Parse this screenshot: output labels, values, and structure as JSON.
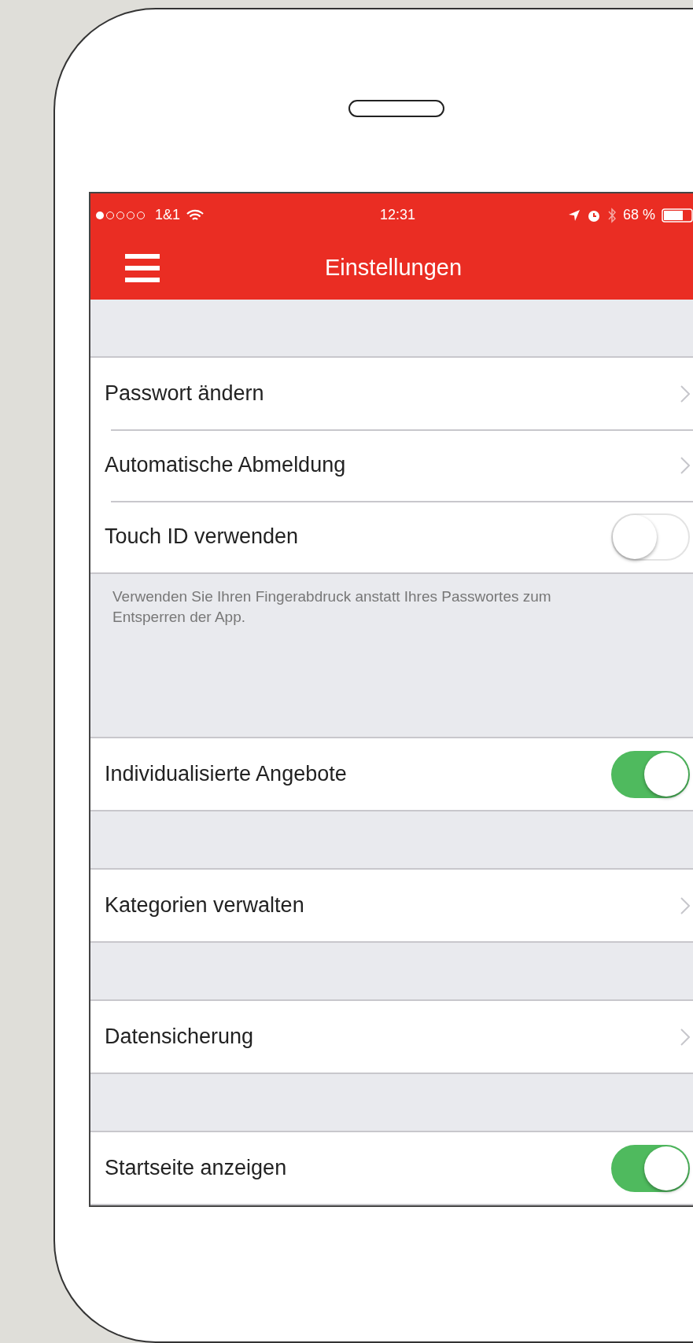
{
  "status_bar": {
    "carrier": "1&1",
    "time": "12:31",
    "battery": "68 %"
  },
  "nav": {
    "title": "Einstellungen"
  },
  "groups": [
    {
      "rows": [
        {
          "kind": "link",
          "label": "Passwort ändern"
        },
        {
          "kind": "link",
          "label": "Automatische Abmeldung"
        },
        {
          "kind": "toggle",
          "label": "Touch ID verwenden",
          "on": false
        }
      ],
      "footer": "Verwenden Sie Ihren Fingerabdruck anstatt Ihres Passwortes zum Entsperren der App."
    },
    {
      "rows": [
        {
          "kind": "toggle",
          "label": "Individualisierte Angebote",
          "on": true
        }
      ]
    },
    {
      "rows": [
        {
          "kind": "link",
          "label": "Kategorien verwalten"
        }
      ]
    },
    {
      "rows": [
        {
          "kind": "link",
          "label": "Datensicherung"
        }
      ]
    },
    {
      "rows": [
        {
          "kind": "toggle",
          "label": "Startseite anzeigen",
          "on": true
        }
      ]
    }
  ]
}
